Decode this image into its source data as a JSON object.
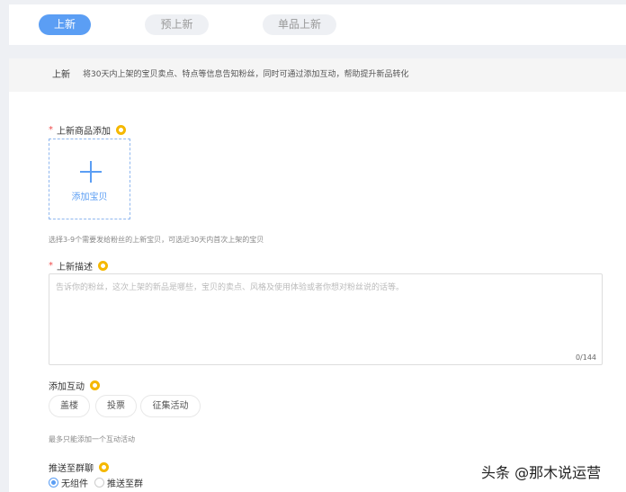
{
  "tabs": [
    {
      "label": "上新",
      "active": true
    },
    {
      "label": "预上新"
    },
    {
      "label": "单品上新"
    }
  ],
  "info": {
    "title": "上新",
    "desc": "将30天内上架的宝贝卖点、特点等信息告知粉丝，同时可通过添加互动，帮助提升新品转化"
  },
  "product": {
    "label": "上新商品添加",
    "required": "*",
    "upload_label": "添加宝贝",
    "hint": "选择3-9个需要发给粉丝的上新宝贝，可选近30天内首次上架的宝贝"
  },
  "desc": {
    "label": "上新描述",
    "required": "*",
    "placeholder": "告诉你的粉丝，这次上架的新品是哪些，宝贝的卖点、风格及使用体验或者你想对粉丝说的话等。",
    "count": "0/144"
  },
  "interaction": {
    "label": "添加互动",
    "options": [
      "盖楼",
      "投票",
      "征集活动"
    ],
    "hint": "最多只能添加一个互动活动"
  },
  "push": {
    "label": "推送至群聊",
    "options": [
      {
        "label": "无组件",
        "selected": true
      },
      {
        "label": "推送至群",
        "selected": false
      }
    ]
  },
  "watermark": "头条 @那木说运营"
}
